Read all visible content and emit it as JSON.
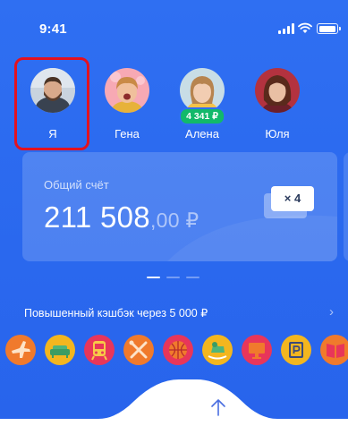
{
  "status_bar": {
    "time": "9:41"
  },
  "people": [
    {
      "name": "Я",
      "selected": true
    },
    {
      "name": "Гена"
    },
    {
      "name": "Алена",
      "balance": "4 341 ₽"
    },
    {
      "name": "Юля"
    }
  ],
  "account": {
    "label": "Общий счёт",
    "amount_main": "211 508",
    "amount_kop": ",00 ₽",
    "multiplier": "× 4"
  },
  "pager": {
    "count": 3,
    "active": 0
  },
  "cashback": {
    "text": "Повышенный кэшбэк через 5 000 ₽"
  },
  "categories": [
    {
      "icon": "airplane-icon",
      "color": "#f07a2c"
    },
    {
      "icon": "sofa-icon",
      "color": "#f3b61f"
    },
    {
      "icon": "train-icon",
      "color": "#e8365a"
    },
    {
      "icon": "cutlery-icon",
      "color": "#f07a2c"
    },
    {
      "icon": "basketball-icon",
      "color": "#e8365a"
    },
    {
      "icon": "rocking-horse-icon",
      "color": "#f3b61f"
    },
    {
      "icon": "monitor-icon",
      "color": "#e8365a"
    },
    {
      "icon": "parking-icon",
      "color": "#f3b61f"
    },
    {
      "icon": "book-icon",
      "color": "#f07a2c"
    }
  ],
  "colors": {
    "background": "#2b6cf0",
    "badge": "#12b96a",
    "selection": "#e3121f"
  }
}
